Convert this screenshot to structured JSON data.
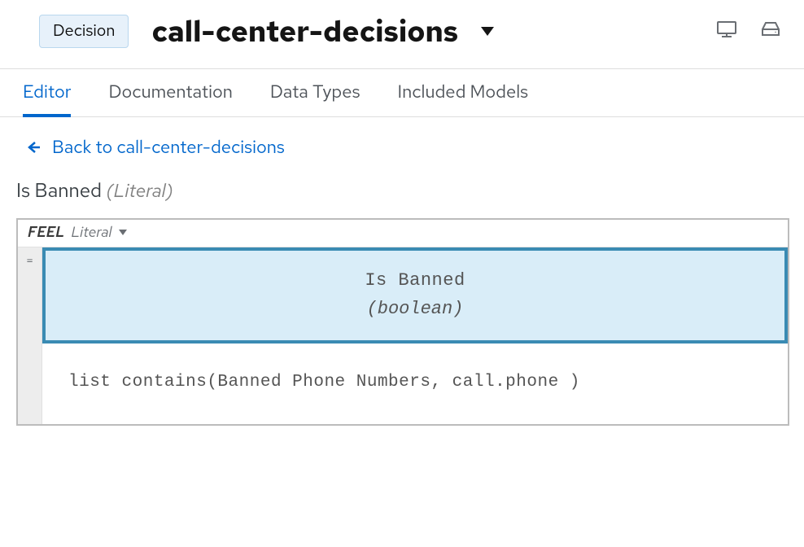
{
  "header": {
    "badge": "Decision",
    "title": "call-center-decisions"
  },
  "tabs": {
    "items": [
      {
        "label": "Editor",
        "active": true
      },
      {
        "label": "Documentation",
        "active": false
      },
      {
        "label": "Data Types",
        "active": false
      },
      {
        "label": "Included Models",
        "active": false
      }
    ]
  },
  "back": {
    "label": "Back to call-center-decisions"
  },
  "subtitle": {
    "name": "Is Banned",
    "kind": "(Literal)"
  },
  "feel": {
    "label": "FEEL",
    "kind": "Literal"
  },
  "expression": {
    "eq": "=",
    "typeName": "Is Banned",
    "typeKind": "(boolean)",
    "code": "list contains(Banned Phone Numbers, call.phone )"
  }
}
